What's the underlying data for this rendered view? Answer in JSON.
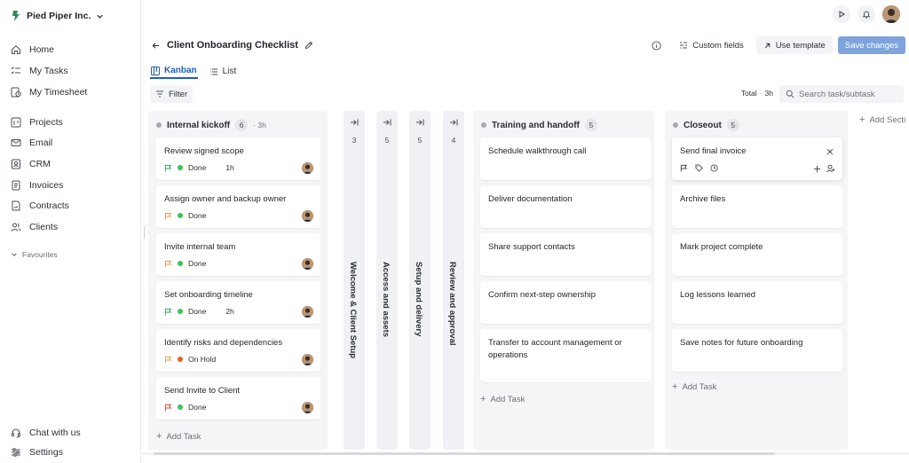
{
  "org": {
    "name": "Pied Piper Inc."
  },
  "nav": {
    "home": "Home",
    "my_tasks": "My Tasks",
    "my_timesheet": "My Timesheet",
    "projects": "Projects",
    "email": "Email",
    "crm": "CRM",
    "invoices": "Invoices",
    "contracts": "Contracts",
    "clients": "Clients",
    "favourites": "Favourites",
    "chat_with_us": "Chat with us",
    "settings": "Settings"
  },
  "page": {
    "title": "Client Onboarding Checklist",
    "custom_fields": "Custom fields",
    "use_template": "Use template",
    "save_changes": "Save changes"
  },
  "views": {
    "kanban": "Kanban",
    "list": "List"
  },
  "toolbar": {
    "filter": "Filter",
    "total_label": "Total",
    "total_value": "3h",
    "search_placeholder": "Search task/subtask"
  },
  "columns": {
    "internal": {
      "title": "Internal kickoff",
      "count": "6",
      "time": "3h",
      "cards": [
        {
          "title": "Review signed scope",
          "status": "Done",
          "estimate": "1h"
        },
        {
          "title": "Assign owner and backup owner",
          "status": "Done",
          "estimate": ""
        },
        {
          "title": "Invite internal team",
          "status": "Done",
          "estimate": ""
        },
        {
          "title": "Set onboarding timeline",
          "status": "Done",
          "estimate": "2h"
        },
        {
          "title": "Identify risks and dependencies",
          "status": "On Hold",
          "estimate": ""
        },
        {
          "title": "Send Invite to Client",
          "status": "Done",
          "estimate": ""
        }
      ],
      "add_task": "Add Task"
    },
    "collapsed": [
      {
        "title": "Welcome & Client Setup",
        "count": "3"
      },
      {
        "title": "Access and assets",
        "count": "5"
      },
      {
        "title": "Setup and delivery",
        "count": "5"
      },
      {
        "title": "Review and approval",
        "count": "4"
      }
    ],
    "training": {
      "title": "Training and handoff",
      "count": "5",
      "cards": [
        {
          "title": "Schedule walkthrough call"
        },
        {
          "title": "Deliver documentation"
        },
        {
          "title": "Share support contacts"
        },
        {
          "title": "Confirm next-step ownership"
        },
        {
          "title": "Transfer to account management or operations"
        }
      ],
      "add_task": "Add Task"
    },
    "closeout": {
      "title": "Closeout",
      "count": "5",
      "cards": [
        {
          "title": "Send final invoice"
        },
        {
          "title": "Archive files"
        },
        {
          "title": "Mark project complete"
        },
        {
          "title": "Log lessons learned"
        },
        {
          "title": "Save notes for future onboarding"
        }
      ],
      "add_task": "Add Task"
    },
    "add_section": "Add Secti"
  },
  "colors": {
    "accent": "#1f5fb8",
    "done": "#3fbf5f",
    "on_hold": "#e0632a",
    "flag_green": "#2fae5a",
    "flag_orange": "#e8a23a",
    "flag_red": "#e0443a"
  }
}
